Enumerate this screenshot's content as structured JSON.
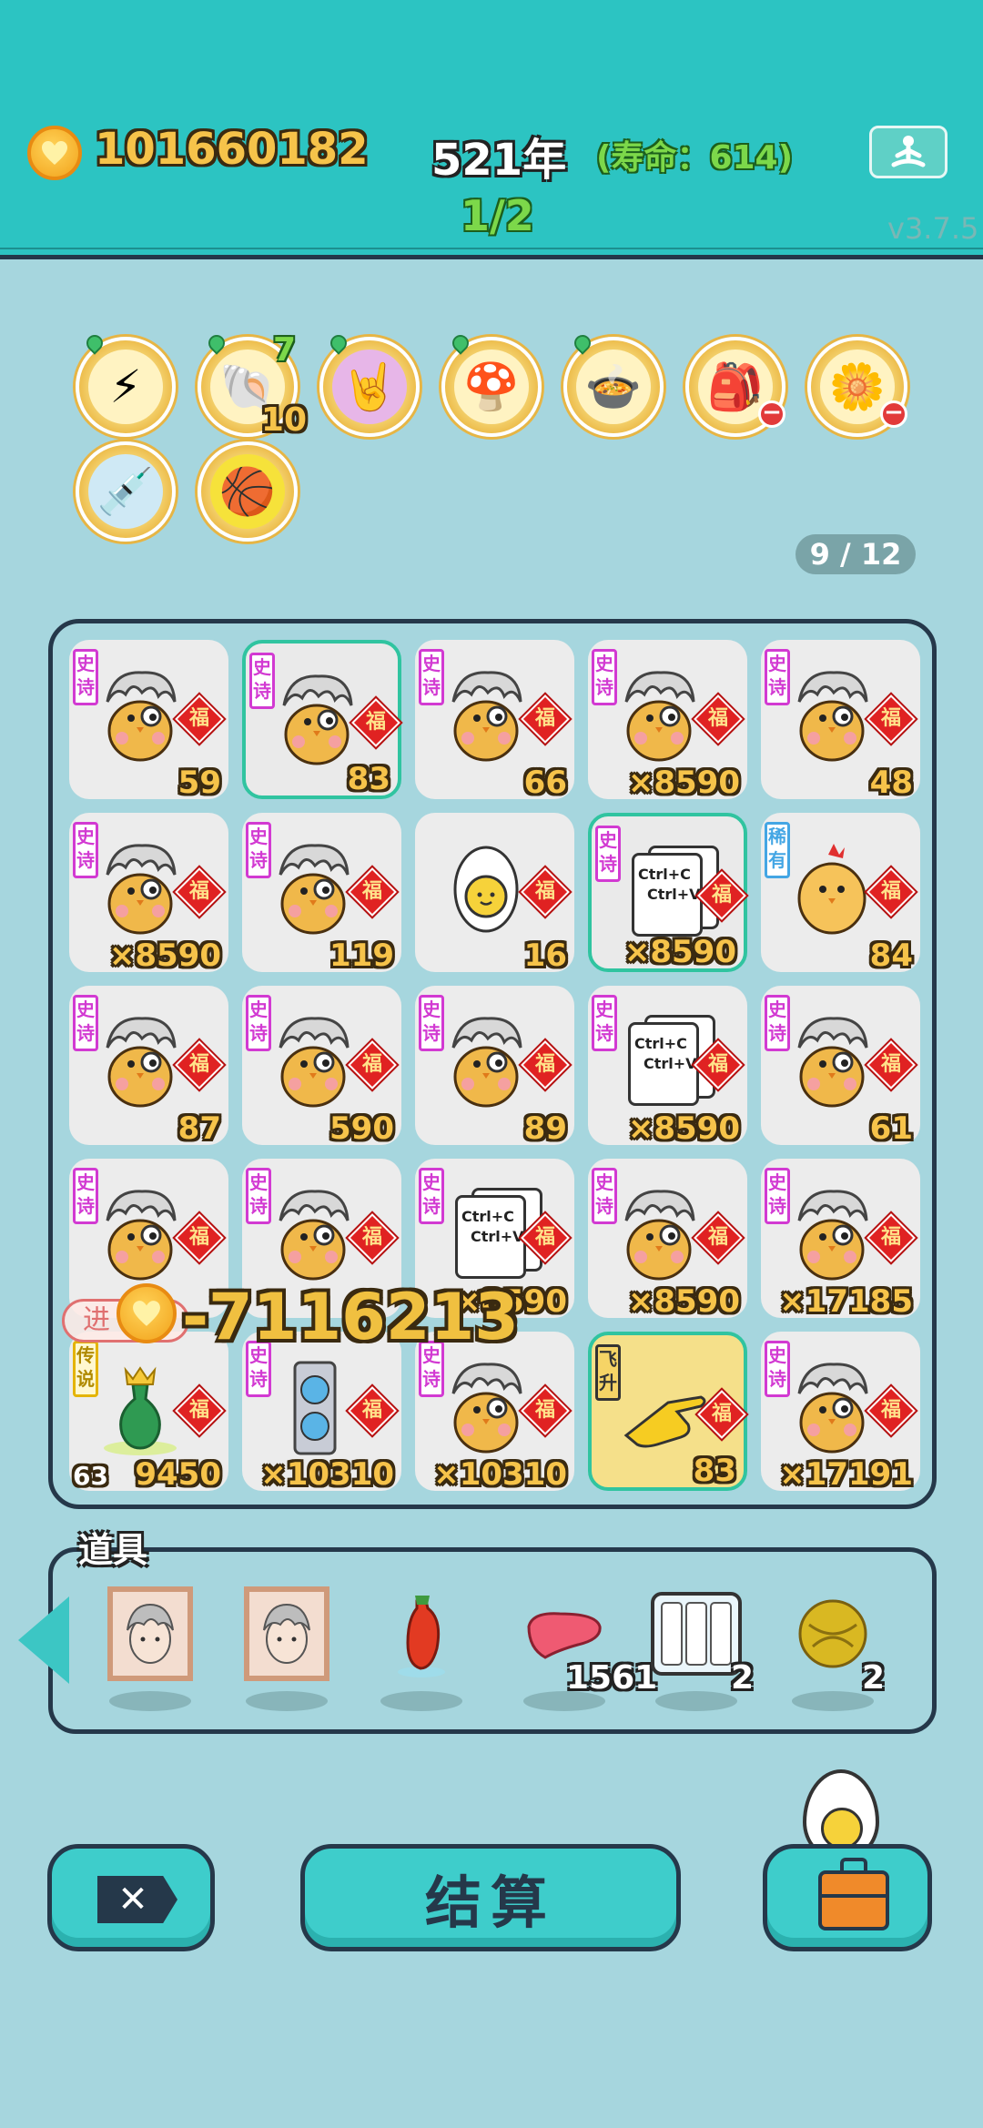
{
  "header": {
    "coins": "101660182",
    "year": "521年",
    "lifespan": "(寿命：614)",
    "progress": "1/2",
    "version": "v3.7.5",
    "meditate_icon": "meditating-person-icon"
  },
  "buffs": [
    {
      "icon": "lightning-icon",
      "glyph": "⚡",
      "pinned": true
    },
    {
      "icon": "shell-icon",
      "glyph": "🐚",
      "pinned": true,
      "top_badge": "7",
      "bottom_badge": "10"
    },
    {
      "icon": "rock-hand-icon",
      "glyph": "🤘",
      "pinned": true
    },
    {
      "icon": "mushroom-cloud-icon",
      "glyph": "🍄",
      "pinned": true
    },
    {
      "icon": "rice-cooker-icon",
      "glyph": "🍲",
      "pinned": true
    },
    {
      "icon": "sack-icon",
      "glyph": "🎒",
      "pinned": false,
      "minus": true
    },
    {
      "icon": "potted-flower-icon",
      "glyph": "🌼",
      "pinned": false,
      "minus": true
    },
    {
      "icon": "syringe-chick-icon",
      "glyph": "💉",
      "pinned": false
    },
    {
      "icon": "basketballs-icon",
      "glyph": "🏀",
      "pinned": false
    }
  ],
  "board_counter": "9 / 12",
  "tags": {
    "epic": "史诗",
    "rare": "稀有",
    "legend": "传说",
    "fly": "飞升",
    "fortune": "福"
  },
  "cells": [
    {
      "tag": "epic",
      "item": "gray-hair-chick",
      "num": "59"
    },
    {
      "tag": "epic",
      "item": "gray-hair-chick",
      "num": "83",
      "selected": true
    },
    {
      "tag": "epic",
      "item": "gray-hair-chick",
      "num": "66"
    },
    {
      "tag": "epic",
      "item": "gray-hair-chick",
      "num": "×8590"
    },
    {
      "tag": "epic",
      "item": "gray-hair-chick",
      "num": "48"
    },
    {
      "tag": "epic",
      "item": "gray-hair-chick",
      "num": "×8590"
    },
    {
      "tag": "epic",
      "item": "gray-hair-chick",
      "num": "119"
    },
    {
      "tag": "",
      "item": "egg",
      "num": "16"
    },
    {
      "tag": "epic",
      "item": "ctrl-cv",
      "num": "×8590",
      "selected": true
    },
    {
      "tag": "rare",
      "item": "chick",
      "num": "84"
    },
    {
      "tag": "epic",
      "item": "gray-hair-chick",
      "num": "87"
    },
    {
      "tag": "epic",
      "item": "gray-hair-chick",
      "num": "590"
    },
    {
      "tag": "epic",
      "item": "gray-hair-chick",
      "num": "89"
    },
    {
      "tag": "epic",
      "item": "ctrl-cv",
      "num": "×8590"
    },
    {
      "tag": "epic",
      "item": "gray-hair-chick",
      "num": "61"
    },
    {
      "tag": "epic",
      "item": "gray-hair-chick",
      "num": ""
    },
    {
      "tag": "epic",
      "item": "gray-hair-chick",
      "num": ""
    },
    {
      "tag": "epic",
      "item": "ctrl-cv",
      "num": "×8590"
    },
    {
      "tag": "epic",
      "item": "gray-hair-chick",
      "num": "×8590"
    },
    {
      "tag": "epic",
      "item": "gray-hair-chick",
      "num": "×17185"
    },
    {
      "tag": "legend",
      "item": "vase",
      "num": "9450",
      "prefix": "63"
    },
    {
      "tag": "epic",
      "item": "gpu",
      "num": "×10310"
    },
    {
      "tag": "epic",
      "item": "gray-hair-chick",
      "num": "×10310"
    },
    {
      "tag": "fly",
      "item": "pointing-hand",
      "num": "83",
      "gold": true
    },
    {
      "tag": "epic",
      "item": "gray-hair-chick",
      "num": "×17191"
    }
  ],
  "ctrl_text": [
    "Ctrl+C",
    "Ctrl+V"
  ],
  "floater": "-7116213",
  "advance_label": "进",
  "props": {
    "label": "道具",
    "items": [
      {
        "icon": "portrait-frame-icon",
        "count": ""
      },
      {
        "icon": "portrait-frame-icon",
        "count": ""
      },
      {
        "icon": "chili-pepper-icon",
        "count": ""
      },
      {
        "icon": "liver-icon",
        "count": "1561"
      },
      {
        "icon": "battery-icon",
        "count": "2"
      },
      {
        "icon": "gold-ball-icon",
        "count": "2"
      }
    ]
  },
  "buttons": {
    "settle": "结算",
    "cancel_icon": "close-icon",
    "bag_icon": "briefcase-icon"
  },
  "colors": {
    "header": "#2cc4c2",
    "background": "#a6d6de",
    "epic": "#d23ad2",
    "fortune": "#e02222",
    "gold": "#f6c34a"
  }
}
